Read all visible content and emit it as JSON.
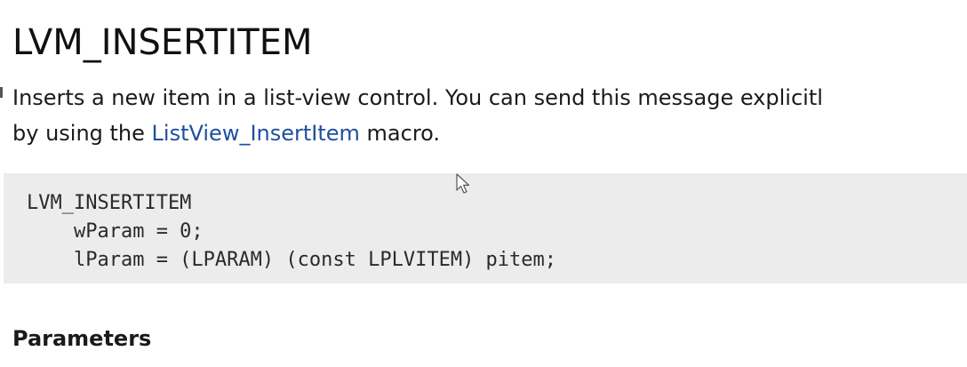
{
  "page": {
    "title": "LVM_INSERTITEM",
    "intro": {
      "line1": "Inserts a new item in a list-view control. You can send this message explicitl",
      "line2_before": "by using the ",
      "line2_link": "ListView_InsertItem",
      "line2_after": " macro."
    },
    "code": [
      "LVM_INSERTITEM",
      "    wParam = 0;",
      "    lParam = (LPARAM) (const LPLVITEM) pitem;"
    ],
    "section_heading": "Parameters"
  },
  "colors": {
    "link": "#1f4fa0",
    "code_background": "#ececec"
  },
  "icons": {
    "cursor": "mouse-pointer-icon"
  }
}
